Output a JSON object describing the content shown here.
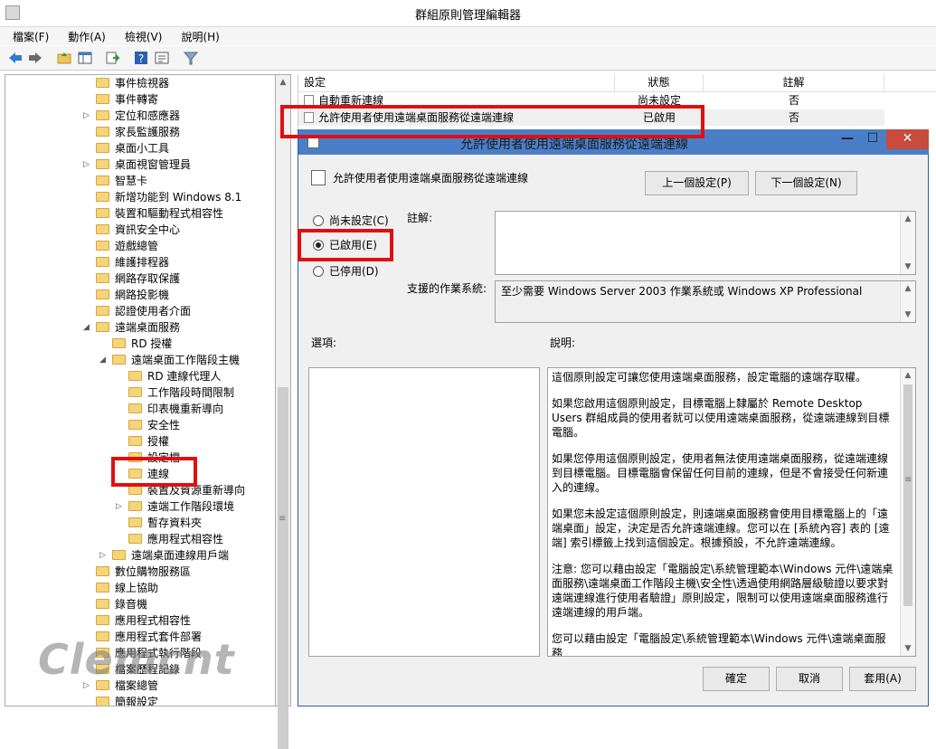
{
  "window": {
    "title": "群組原則管理編輯器"
  },
  "menu": [
    "檔案(F)",
    "動作(A)",
    "檢視(V)",
    "說明(H)"
  ],
  "toolbar": [
    "back-icon",
    "forward-icon",
    "up-folder-icon",
    "show-hide-tree-icon",
    "export-list-icon",
    "help-icon",
    "properties-icon",
    "filter-icon"
  ],
  "tree": [
    {
      "label": "事件檢視器",
      "level": 0,
      "expander": ""
    },
    {
      "label": "事件轉寄",
      "level": 0,
      "expander": ""
    },
    {
      "label": "定位和感應器",
      "level": 0,
      "expander": "▷"
    },
    {
      "label": "家長監護服務",
      "level": 0,
      "expander": ""
    },
    {
      "label": "桌面小工具",
      "level": 0,
      "expander": ""
    },
    {
      "label": "桌面視窗管理員",
      "level": 0,
      "expander": "▷"
    },
    {
      "label": "智慧卡",
      "level": 0,
      "expander": ""
    },
    {
      "label": "新增功能到 Windows 8.1",
      "level": 0,
      "expander": ""
    },
    {
      "label": "裝置和驅動程式相容性",
      "level": 0,
      "expander": ""
    },
    {
      "label": "資訊安全中心",
      "level": 0,
      "expander": ""
    },
    {
      "label": "遊戲總管",
      "level": 0,
      "expander": ""
    },
    {
      "label": "維護排程器",
      "level": 0,
      "expander": ""
    },
    {
      "label": "網路存取保護",
      "level": 0,
      "expander": ""
    },
    {
      "label": "網路投影機",
      "level": 0,
      "expander": ""
    },
    {
      "label": "認證使用者介面",
      "level": 0,
      "expander": ""
    },
    {
      "label": "遠端桌面服務",
      "level": 0,
      "expander": "◢"
    },
    {
      "label": "RD 授權",
      "level": 1,
      "expander": ""
    },
    {
      "label": "遠端桌面工作階段主機",
      "level": 1,
      "expander": "◢"
    },
    {
      "label": "RD 連線代理人",
      "level": 2,
      "expander": ""
    },
    {
      "label": "工作階段時間限制",
      "level": 2,
      "expander": ""
    },
    {
      "label": "印表機重新導向",
      "level": 2,
      "expander": ""
    },
    {
      "label": "安全性",
      "level": 2,
      "expander": ""
    },
    {
      "label": "授權",
      "level": 2,
      "expander": ""
    },
    {
      "label": "設定檔",
      "level": 2,
      "expander": ""
    },
    {
      "label": "連線",
      "level": 2,
      "expander": ""
    },
    {
      "label": "裝置及資源重新導向",
      "level": 2,
      "expander": ""
    },
    {
      "label": "遠端工作階段環境",
      "level": 2,
      "expander": "▷"
    },
    {
      "label": "暫存資料夾",
      "level": 2,
      "expander": ""
    },
    {
      "label": "應用程式相容性",
      "level": 2,
      "expander": ""
    },
    {
      "label": "遠端桌面連線用戶端",
      "level": 1,
      "expander": "▷"
    },
    {
      "label": "數位購物服務區",
      "level": 0,
      "expander": ""
    },
    {
      "label": "線上協助",
      "level": 0,
      "expander": ""
    },
    {
      "label": "錄音機",
      "level": 0,
      "expander": ""
    },
    {
      "label": "應用程式相容性",
      "level": 0,
      "expander": ""
    },
    {
      "label": "應用程式套件部署",
      "level": 0,
      "expander": ""
    },
    {
      "label": "應用程式執行階段",
      "level": 0,
      "expander": ""
    },
    {
      "label": "檔案歷程記錄",
      "level": 0,
      "expander": ""
    },
    {
      "label": "檔案總管",
      "level": 0,
      "expander": "▷"
    },
    {
      "label": "簡報設定",
      "level": 0,
      "expander": ""
    }
  ],
  "list": {
    "headers": {
      "setting": "設定",
      "state": "狀態",
      "comment": "註解"
    },
    "rows": [
      {
        "name": "自動重新連線",
        "state": "尚未設定",
        "comment": "否"
      },
      {
        "name": "允許使用者使用遠端桌面服務從遠端連線",
        "state": "已啟用",
        "comment": "否"
      }
    ]
  },
  "dialog": {
    "title": "允許使用者使用遠端桌面服務從遠端連線",
    "setting_name": "允許使用者使用遠端桌面服務從遠端連線",
    "prev_button": "上一個設定(P)",
    "next_button": "下一個設定(N)",
    "radio_not_configured": "尚未設定(C)",
    "radio_enabled": "已啟用(E)",
    "radio_disabled": "已停用(D)",
    "comment_label": "註解:",
    "supported_label": "支援的作業系統:",
    "supported_value": "至少需要 Windows Server 2003 作業系統或 Windows XP Professional",
    "options_label": "選項:",
    "help_label": "說明:",
    "help_paragraphs": [
      "這個原則設定可讓您使用遠端桌面服務，設定電腦的遠端存取權。",
      "如果您啟用這個原則設定，目標電腦上隸屬於 Remote Desktop Users 群組成員的使用者就可以使用遠端桌面服務，從遠端連線到目標電腦。",
      "如果您停用這個原則設定，使用者無法使用遠端桌面服務，從遠端連線到目標電腦。目標電腦會保留任何目前的連線，但是不會接受任何新連入的連線。",
      "如果您未設定這個原則設定，則遠端桌面服務會使用目標電腦上的「遠端桌面」設定，決定是否允許遠端連線。您可以在 [系統內容] 表的 [遠端] 索引標籤上找到這個設定。根據預設，不允許遠端連線。",
      "注意: 您可以藉由設定「電腦設定\\系統管理範本\\Windows 元件\\遠端桌面服務\\遠端桌面工作階段主機\\安全性\\透過使用網路層級驗證以要求對遠端連線進行使用者驗證」原則設定，限制可以使用遠端桌面服務進行遠端連線的用戶端。",
      "您可以藉由設定「電腦設定\\系統管理範本\\Windows 元件\\遠端桌面服務"
    ],
    "ok_button": "確定",
    "cancel_button": "取消",
    "apply_button": "套用(A)"
  },
  "watermark": "Clemcnt",
  "colors": {
    "highlight_red": "#e01010",
    "dialog_title": "#4a7fc8",
    "close_red": "#c84b3c"
  }
}
